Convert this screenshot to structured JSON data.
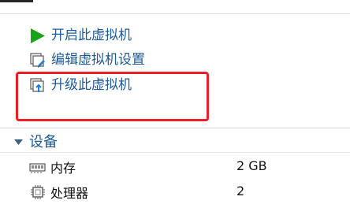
{
  "vm_actions": [
    {
      "label": "开启此虚拟机",
      "icon": "play-icon"
    },
    {
      "label": "编辑虚拟机设置",
      "icon": "edit-settings-icon"
    },
    {
      "label": "升级此虚拟机",
      "icon": "upgrade-vm-icon"
    }
  ],
  "devices_section": {
    "title": "设备",
    "items": [
      {
        "label": "内存",
        "value": "2 GB",
        "icon": "memory-icon"
      },
      {
        "label": "处理器",
        "value": "2",
        "icon": "processor-icon"
      }
    ]
  },
  "colors": {
    "link_blue": "#1f5a96",
    "highlight_red": "#ef1d25",
    "play_green": "#19a319"
  }
}
